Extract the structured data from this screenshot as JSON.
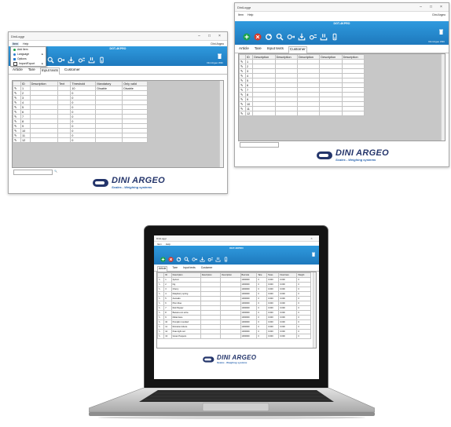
{
  "app": {
    "title": "DiniLoggr"
  },
  "menu": {
    "file": "Item",
    "help": "Help",
    "right_link": "Dini Argeo"
  },
  "device": {
    "model": "DGT-4KPRO",
    "status": "Dini Argeo WiFi"
  },
  "file_menu": {
    "items": [
      {
        "label": "Add Item",
        "icon": "add-icon",
        "color": "#1aa34a"
      },
      {
        "label": "Language",
        "icon": "globe-icon",
        "color": "#2a7dd0",
        "submenu": true
      },
      {
        "label": "Options",
        "icon": "options-icon",
        "color": "#2a7dd0"
      },
      {
        "label": "Import/Export",
        "icon": "import-icon",
        "color": "#444444",
        "submenu": true
      }
    ]
  },
  "win1": {
    "tabs": [
      "Article",
      "Tare",
      "Input texts",
      "Customer"
    ],
    "selected_tab": "Input texts",
    "columns": [
      "ID",
      "Description",
      "Text",
      "Threshold",
      "Mandatory",
      "Only valid"
    ],
    "rows": [
      {
        "id": "1",
        "desc": "",
        "text": "",
        "thr": "10",
        "mand": "Disable",
        "only": "Disable"
      },
      {
        "id": "2",
        "thr": "0"
      },
      {
        "id": "3",
        "thr": "0"
      },
      {
        "id": "4",
        "thr": "0"
      },
      {
        "id": "5",
        "thr": "0"
      },
      {
        "id": "6",
        "thr": "0"
      },
      {
        "id": "7",
        "thr": "0"
      },
      {
        "id": "8",
        "thr": "0"
      },
      {
        "id": "9",
        "thr": "0"
      },
      {
        "id": "10",
        "thr": "0"
      },
      {
        "id": "11",
        "thr": "0"
      },
      {
        "id": "12",
        "thr": "0"
      }
    ]
  },
  "win2": {
    "tabs": [
      "Article",
      "Tare",
      "Input texts",
      "Customer"
    ],
    "selected_tab": "Customer",
    "columns": [
      "ID",
      "Description",
      "Description",
      "Description",
      "Description",
      "Description"
    ],
    "rows": [
      "1",
      "2",
      "3",
      "4",
      "5",
      "6",
      "7",
      "8",
      "9",
      "10",
      "11",
      "12"
    ]
  },
  "win3": {
    "tabs": [
      "Article",
      "Tare",
      "Input texts",
      "Customer"
    ],
    "selected_tab": "Article",
    "columns": [
      "ID",
      "Description",
      "Description",
      "Description",
      "Barcode",
      "Tare",
      "Tares",
      "Fixed tare",
      "Weight"
    ],
    "rows": [
      {
        "id": "1",
        "desc": "Apricot",
        "code": "1000000",
        "tare": "0",
        "tares": "0.000",
        "fixed": "0.000",
        "w": "0"
      },
      {
        "id": "2",
        "desc": "Fig",
        "code": "1000000",
        "tare": "0",
        "tares": "0.000",
        "fixed": "0.000",
        "w": "0"
      },
      {
        "id": "3",
        "desc": "Cherry",
        "code": "1000000",
        "tare": "0",
        "tares": "0.000",
        "fixed": "0.000",
        "w": "0"
      },
      {
        "id": "4",
        "desc": "Raspberry spring",
        "code": "1000000",
        "tare": "0",
        "tares": "0.000",
        "fixed": "0.000",
        "w": "0"
      },
      {
        "id": "5",
        "desc": "Avocado",
        "code": "1000000",
        "tare": "0",
        "tares": "0.000",
        "fixed": "0.000",
        "w": "0"
      },
      {
        "id": "6",
        "desc": "Plum blue",
        "code": "1000000",
        "tare": "0",
        "tares": "0.000",
        "fixed": "0.000",
        "w": "0"
      },
      {
        "id": "7",
        "desc": "Red Pepper",
        "code": "1000000",
        "tare": "0",
        "tares": "0.000",
        "fixed": "0.000",
        "w": "0"
      },
      {
        "id": "8",
        "desc": "Banana oro extra",
        "code": "1000000",
        "tare": "0",
        "tares": "0.000",
        "fixed": "0.000",
        "w": "0"
      },
      {
        "id": "9",
        "desc": "Melanzane",
        "code": "1000000",
        "tare": "0",
        "tares": "0.000",
        "fixed": "0.000",
        "w": "0"
      },
      {
        "id": "10",
        "desc": "Pumpkin rounded",
        "code": "1000000",
        "tare": "0",
        "tares": "0.000",
        "fixed": "0.000",
        "w": "0"
      },
      {
        "id": "11",
        "desc": "Romaine lettuce",
        "code": "1000000",
        "tare": "0",
        "tares": "0.000",
        "fixed": "0.000",
        "w": "0"
      },
      {
        "id": "12",
        "desc": "Peas light red",
        "code": "1000000",
        "tare": "0",
        "tares": "0.000",
        "fixed": "0.000",
        "w": "0"
      },
      {
        "id": "13",
        "desc": "Green Peppers",
        "code": "1000000",
        "tare": "0",
        "tares": "0.000",
        "fixed": "0.000",
        "w": "0"
      }
    ]
  },
  "toolbar": {
    "icons": [
      "add-icon",
      "delete-icon",
      "refresh-icon",
      "search-icon",
      "send-icon",
      "receive-icon",
      "send-all-icon",
      "receive-all-icon",
      "device-icon"
    ],
    "trash_icon": "trash-icon"
  },
  "logo": {
    "brand": "DINI ARGEO",
    "tagline": "Scales - Weighing systems"
  },
  "colors": {
    "blue_bar_top": "#2f9ade",
    "blue_bar_bottom": "#1e79bd",
    "logo_brand": "#24356b",
    "grid_empty": "#c7c7c7"
  }
}
